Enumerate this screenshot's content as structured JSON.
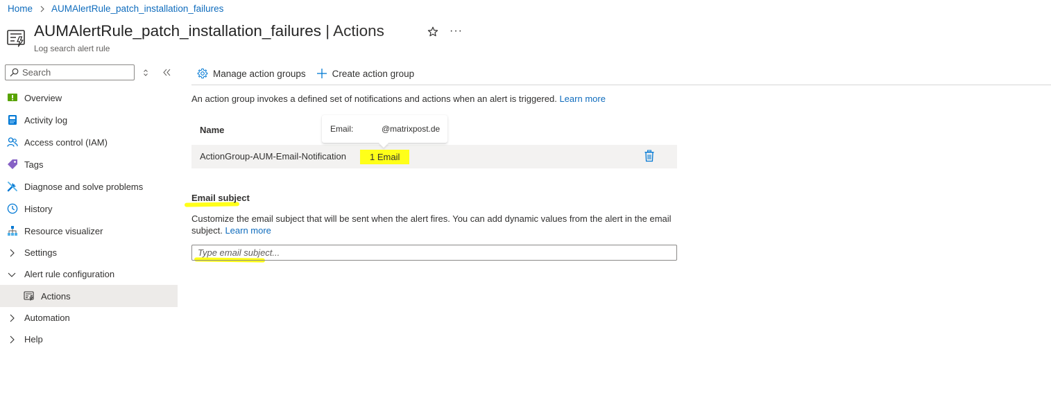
{
  "breadcrumb": {
    "home": "Home",
    "current": "AUMAlertRule_patch_installation_failures"
  },
  "header": {
    "resource_name": "AUMAlertRule_patch_installation_failures",
    "section": " | Actions",
    "resource_type": "Log search alert rule",
    "more": "···"
  },
  "sidebar": {
    "search_placeholder": "Search",
    "items": [
      {
        "label": "Overview",
        "icon": "overview-icon"
      },
      {
        "label": "Activity log",
        "icon": "activity-log-icon"
      },
      {
        "label": "Access control (IAM)",
        "icon": "people-icon"
      },
      {
        "label": "Tags",
        "icon": "tag-icon"
      },
      {
        "label": "Diagnose and solve problems",
        "icon": "wrench-icon"
      },
      {
        "label": "History",
        "icon": "clock-icon"
      },
      {
        "label": "Resource visualizer",
        "icon": "hierarchy-icon"
      }
    ],
    "groups": {
      "settings": "Settings",
      "alert_rule_configuration": "Alert rule configuration",
      "actions": "Actions",
      "automation": "Automation",
      "help": "Help"
    }
  },
  "toolbar": {
    "manage": "Manage action groups",
    "create": "Create action group"
  },
  "main": {
    "description": "An action group invokes a defined set of notifications and actions when an alert is triggered.",
    "learn_more": "Learn more",
    "table": {
      "header_name": "Name",
      "rows": [
        {
          "name": "ActionGroup-AUM-Email-Notification",
          "actions": "1 Email"
        }
      ]
    },
    "tooltip": {
      "label": "Email:",
      "value": "@matrixpost.de"
    },
    "email_subject": {
      "title": "Email subject",
      "hint": "Customize the email subject that will be sent when the alert fires. You can add dynamic values from the alert in the email subject.",
      "learn_more": "Learn more",
      "placeholder": "Type email subject..."
    }
  },
  "colors": {
    "link": "#0f6cbd",
    "highlight": "#ffff19",
    "selected_nav": "#edebe9",
    "row_bg": "#f3f2f1"
  }
}
